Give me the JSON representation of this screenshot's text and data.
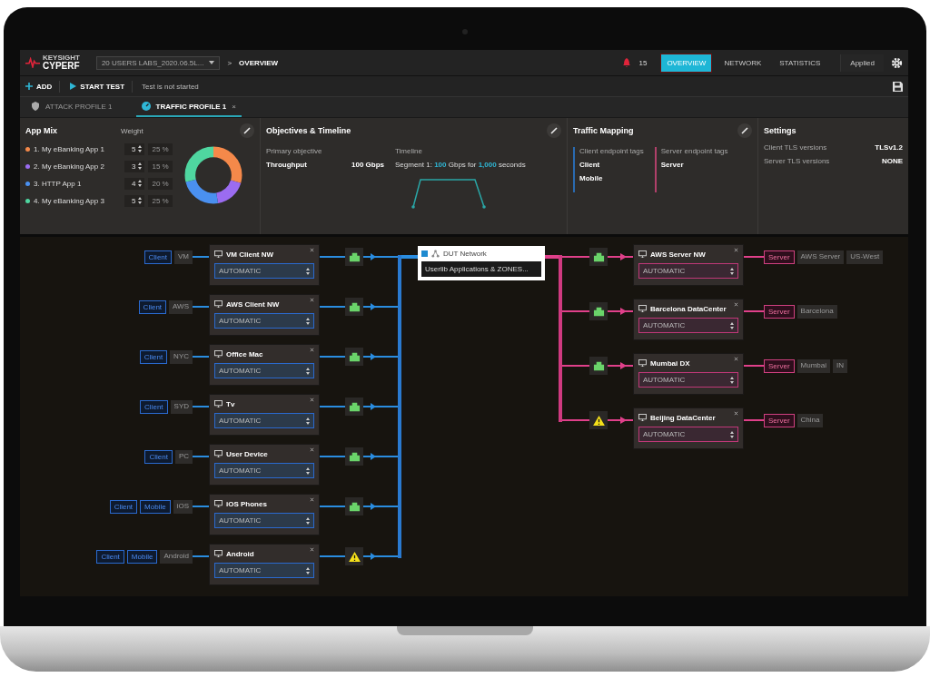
{
  "header": {
    "logo_top": "KEYSIGHT",
    "logo_bottom": "CYPERF",
    "session": "20 USERS LABS_2020.06.5L...",
    "breadcrumb_sep": ">",
    "breadcrumb": "OVERVIEW",
    "alert_count": "15",
    "nav": [
      {
        "label": "OVERVIEW",
        "selected": true
      },
      {
        "label": "NETWORK",
        "selected": false
      },
      {
        "label": "STATISTICS",
        "selected": false
      }
    ],
    "applied": "Applied"
  },
  "toolbar": {
    "add": "ADD",
    "start": "START TEST",
    "status": "Test is not started"
  },
  "tabs": [
    {
      "label": "ATTACK PROFILE 1",
      "kind": "attack",
      "selected": false
    },
    {
      "label": "TRAFFIC PROFILE 1",
      "kind": "traffic",
      "selected": true,
      "close": "×"
    }
  ],
  "app_mix": {
    "title": "App Mix",
    "weight_heading": "Weight",
    "apps": [
      {
        "name": "1. My eBanking App 1",
        "weight": "5",
        "percent": "25 %",
        "color": "#f5894a"
      },
      {
        "name": "2. My eBanking App 2",
        "weight": "3",
        "percent": "15 %",
        "color": "#9b6cf0"
      },
      {
        "name": "3. HTTP App 1",
        "weight": "4",
        "percent": "20 %",
        "color": "#4a90f0"
      },
      {
        "name": "4. My eBanking App 3",
        "weight": "5",
        "percent": "25 %",
        "color": "#4fd6a0"
      }
    ]
  },
  "objectives": {
    "title": "Objectives & Timeline",
    "primary_label": "Primary objective",
    "primary": "Throughput",
    "primary_value": "100 Gbps",
    "timeline_label": "Timeline",
    "segment": {
      "label": "Segment 1:",
      "rate": "100",
      "unit": "Gbps for",
      "duration": "1,000",
      "suffix": "seconds"
    }
  },
  "traffic_mapping": {
    "title": "Traffic Mapping",
    "client_heading": "Client endpoint tags",
    "client_tags": [
      "Client",
      "Mobile"
    ],
    "server_heading": "Server endpoint tags",
    "server_tags": [
      "Server"
    ]
  },
  "settings": {
    "title": "Settings",
    "rows": [
      {
        "label": "Client TLS versions",
        "value": "TLSv1.2"
      },
      {
        "label": "Server TLS versions",
        "value": "NONE"
      }
    ]
  },
  "clients": [
    {
      "name": "VM Client NW",
      "mode": "AUTOMATIC",
      "warning": false,
      "tags": [
        {
          "label": "Client",
          "kind": "role"
        },
        {
          "label": "VM",
          "kind": "plain"
        }
      ]
    },
    {
      "name": "AWS Client NW",
      "mode": "AUTOMATIC",
      "warning": false,
      "tags": [
        {
          "label": "Client",
          "kind": "role"
        },
        {
          "label": "AWS",
          "kind": "plain"
        }
      ]
    },
    {
      "name": "Office Mac",
      "mode": "AUTOMATIC",
      "warning": false,
      "tags": [
        {
          "label": "Client",
          "kind": "role"
        },
        {
          "label": "NYC",
          "kind": "plain"
        }
      ]
    },
    {
      "name": "Tv",
      "mode": "AUTOMATIC",
      "warning": false,
      "tags": [
        {
          "label": "Client",
          "kind": "role"
        },
        {
          "label": "SYD",
          "kind": "plain"
        }
      ]
    },
    {
      "name": "User Device",
      "mode": "AUTOMATIC",
      "warning": false,
      "tags": [
        {
          "label": "Client",
          "kind": "role"
        },
        {
          "label": "PC",
          "kind": "plain"
        }
      ]
    },
    {
      "name": "iOS Phones",
      "mode": "AUTOMATIC",
      "warning": false,
      "tags": [
        {
          "label": "Client",
          "kind": "role"
        },
        {
          "label": "Mobile",
          "kind": "role"
        },
        {
          "label": "iOS",
          "kind": "plain"
        }
      ]
    },
    {
      "name": "Android",
      "mode": "AUTOMATIC",
      "warning": true,
      "tags": [
        {
          "label": "Client",
          "kind": "role"
        },
        {
          "label": "Mobile",
          "kind": "role"
        },
        {
          "label": "Android",
          "kind": "plain"
        }
      ]
    }
  ],
  "dut": {
    "checked": true,
    "name": "DUT Network",
    "action": "Userlib Applications & ZONES..."
  },
  "servers": [
    {
      "name": "AWS Server NW",
      "mode": "AUTOMATIC",
      "warning": false,
      "tags": [
        {
          "label": "Server",
          "kind": "role"
        },
        {
          "label": "AWS Server",
          "kind": "plain"
        },
        {
          "label": "US-West",
          "kind": "plain"
        }
      ]
    },
    {
      "name": "Barcelona DataCenter",
      "mode": "AUTOMATIC",
      "warning": false,
      "tags": [
        {
          "label": "Server",
          "kind": "role"
        },
        {
          "label": "Barcelona",
          "kind": "plain"
        }
      ]
    },
    {
      "name": "Mumbai DX",
      "mode": "AUTOMATIC",
      "warning": false,
      "tags": [
        {
          "label": "Server",
          "kind": "role"
        },
        {
          "label": "Mumbai",
          "kind": "plain"
        },
        {
          "label": "IN",
          "kind": "plain"
        }
      ]
    },
    {
      "name": "Beijing DataCenter",
      "mode": "AUTOMATIC",
      "warning": true,
      "tags": [
        {
          "label": "Server",
          "kind": "role"
        },
        {
          "label": "China",
          "kind": "plain"
        }
      ]
    }
  ]
}
